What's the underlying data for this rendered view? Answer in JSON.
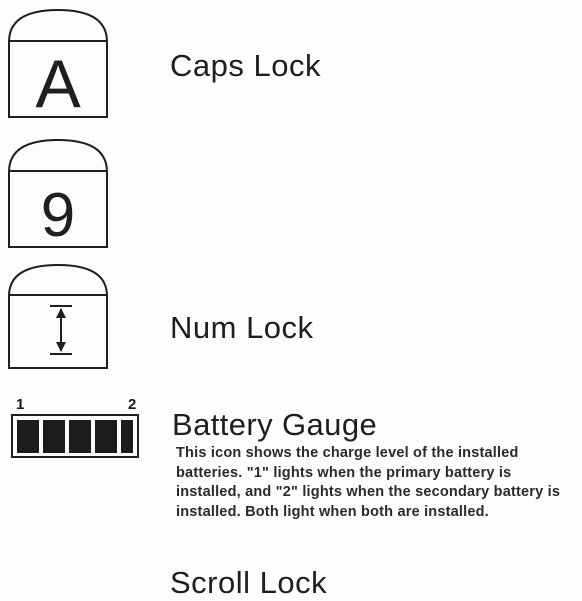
{
  "indicators": [
    {
      "label": "Caps Lock",
      "glyph": "A",
      "icon": "caps-lock-icon"
    },
    {
      "label": "Num Lock",
      "glyph": "9",
      "icon": "num-lock-icon"
    },
    {
      "label": "Scroll Lock",
      "glyph": "",
      "icon": "scroll-lock-icon"
    }
  ],
  "battery": {
    "title": "Battery Gauge",
    "label_1": "1",
    "label_2": "2",
    "icon": "battery-gauge-icon",
    "description": "This icon shows the charge level of the installed batteries. \"1\" lights when the primary battery is installed, and \"2\" lights when the secondary battery is installed. Both light when both are installed."
  }
}
